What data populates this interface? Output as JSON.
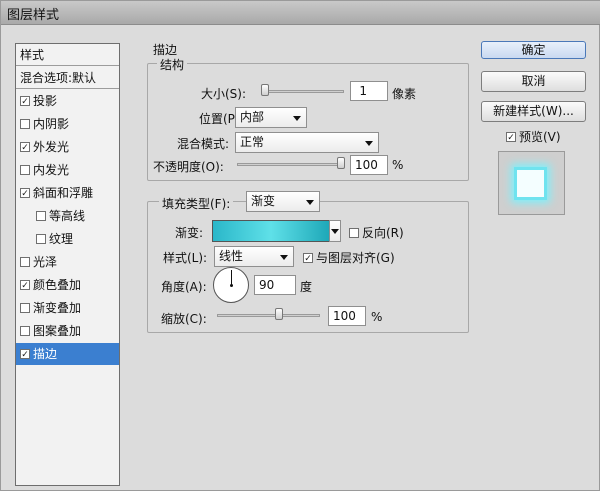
{
  "window": {
    "title": "图层样式"
  },
  "styles_panel": {
    "header": "样式",
    "blend_options": "混合选项:默认",
    "items": [
      {
        "label": "投影",
        "checked": true,
        "indent": false,
        "selected": false
      },
      {
        "label": "内阴影",
        "checked": false,
        "indent": false,
        "selected": false
      },
      {
        "label": "外发光",
        "checked": true,
        "indent": false,
        "selected": false
      },
      {
        "label": "内发光",
        "checked": false,
        "indent": false,
        "selected": false
      },
      {
        "label": "斜面和浮雕",
        "checked": true,
        "indent": false,
        "selected": false
      },
      {
        "label": "等高线",
        "checked": false,
        "indent": true,
        "selected": false
      },
      {
        "label": "纹理",
        "checked": false,
        "indent": true,
        "selected": false
      },
      {
        "label": "光泽",
        "checked": false,
        "indent": false,
        "selected": false
      },
      {
        "label": "颜色叠加",
        "checked": true,
        "indent": false,
        "selected": false
      },
      {
        "label": "渐变叠加",
        "checked": false,
        "indent": false,
        "selected": false
      },
      {
        "label": "图案叠加",
        "checked": false,
        "indent": false,
        "selected": false
      },
      {
        "label": "描边",
        "checked": true,
        "indent": false,
        "selected": true
      }
    ]
  },
  "stroke": {
    "section_title": "描边",
    "structure": {
      "title": "结构",
      "size_label": "大小(S):",
      "size_value": "1",
      "size_unit": "像素",
      "position_label": "位置(P):",
      "position_value": "内部",
      "blend_mode_label": "混合模式:",
      "blend_mode_value": "正常",
      "opacity_label": "不透明度(O):",
      "opacity_value": "100",
      "opacity_unit": "%"
    },
    "fill": {
      "fill_type_label": "填充类型(F):",
      "fill_type_value": "渐变",
      "gradient_label": "渐变:",
      "reverse_label": "反向(R)",
      "style_label": "样式(L):",
      "style_value": "线性",
      "align_label": "与图层对齐(G)",
      "angle_label": "角度(A):",
      "angle_value": "90",
      "angle_unit": "度",
      "scale_label": "缩放(C):",
      "scale_value": "100",
      "scale_unit": "%"
    }
  },
  "buttons": {
    "ok": "确定",
    "cancel": "取消",
    "new_style": "新建样式(W)...",
    "preview": "预览(V)"
  }
}
